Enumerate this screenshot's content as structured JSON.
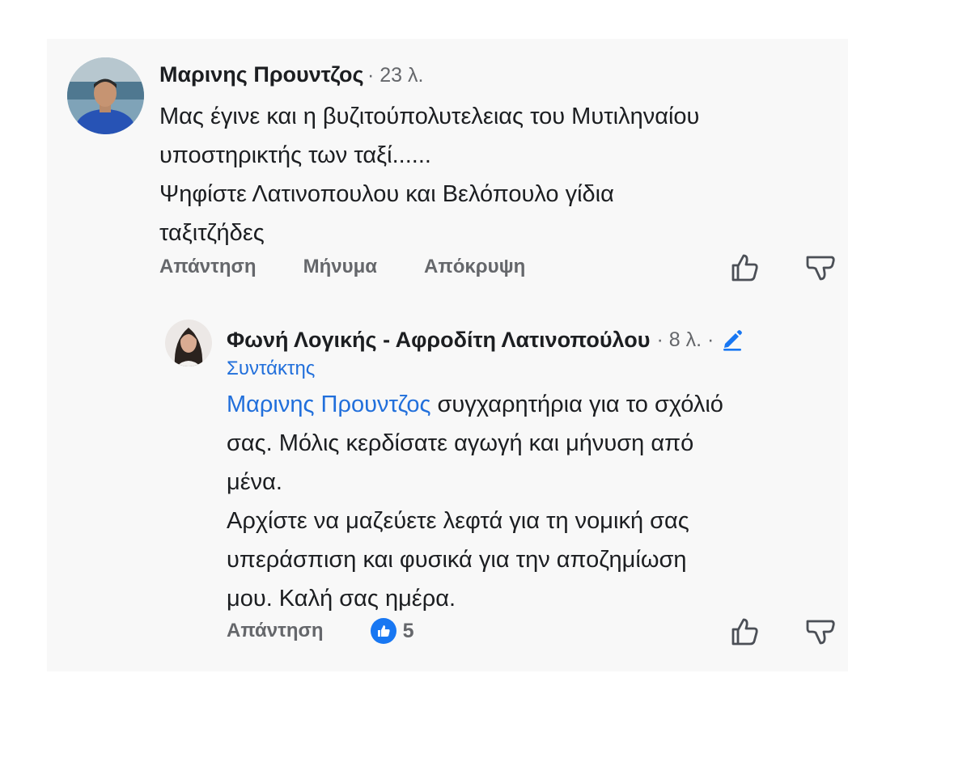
{
  "comment": {
    "author": "Μαρινης Προυντζος",
    "time": "· 23 λ.",
    "text_lines": [
      "Μας έγινε και η βυζιτούπολυτελειας του Μυτιληναίου",
      "υποστηρικτής των ταξί......",
      "Ψηφίστε Λατινοπουλου και Βελόπουλο γίδια",
      "ταξιτζήδες"
    ],
    "actions": {
      "reply": "Απάντηση",
      "message": "Μήνυμα",
      "hide": "Απόκρυψη"
    }
  },
  "reply": {
    "author": "Φωνή Λογικής - Αφροδίτη Λατινοπούλου",
    "time": "· 8 λ. ·",
    "role": "Συντάκτης",
    "mention": "Μαρινης Προυντζος",
    "first_line_rest": " συγχαρητήρια για το σχόλιό",
    "text_lines": [
      "σας. Μόλις κερδίσατε αγωγή και μήνυση από",
      "μένα.",
      "Αρχίστε να μαζεύετε λεφτά για τη νομική σας",
      "υπεράσπιση και φυσικά για την αποζημίωση",
      "μου. Καλή σας ημέρα."
    ],
    "actions": {
      "reply": "Απάντηση"
    },
    "reaction_count": "5"
  },
  "colors": {
    "link": "#216fdb",
    "meta": "#65676b",
    "text": "#1c1e21",
    "like_badge": "#1877f2"
  },
  "icons": {
    "like": "thumbs-up-outline-icon",
    "dislike": "thumbs-down-outline-icon",
    "edit": "pencil-icon",
    "reaction": "like-reaction-icon"
  }
}
